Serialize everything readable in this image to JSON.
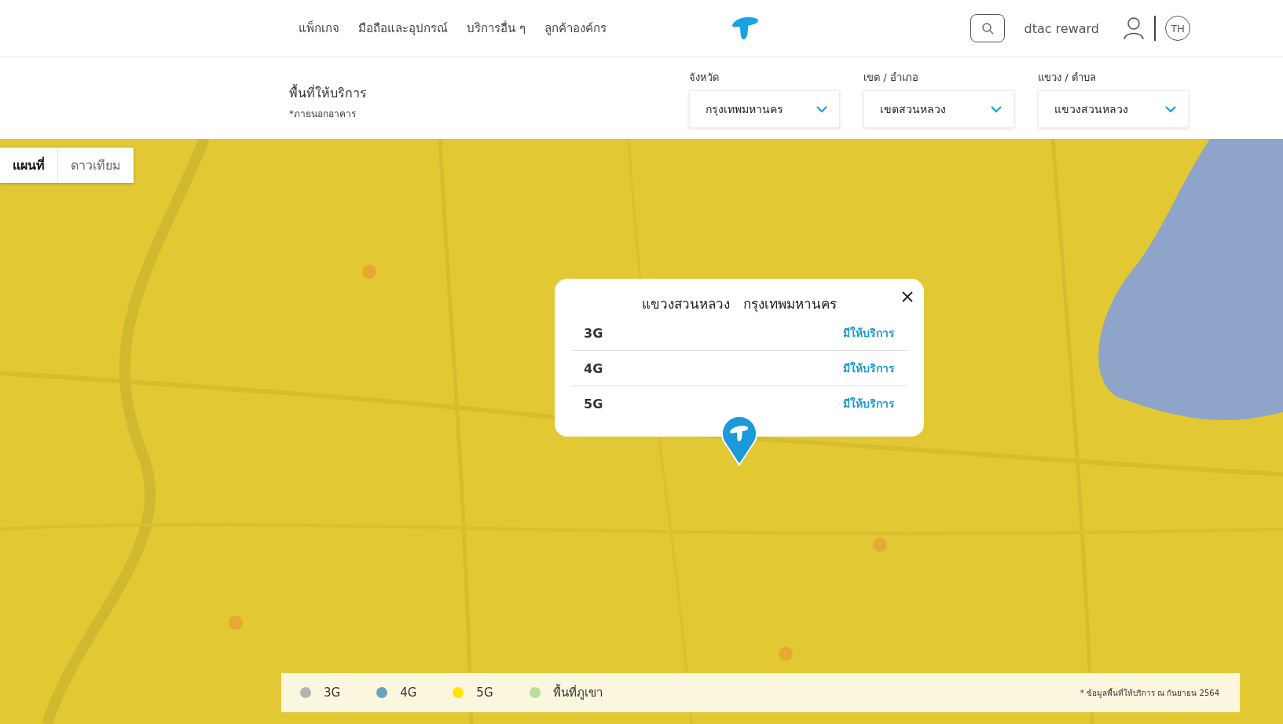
{
  "nav": {
    "items": [
      "แพ็กเกจ",
      "มือถือและอุปกรณ์",
      "บริการอื่น ๆ",
      "ลูกค้าองค์กร"
    ],
    "reward": "dtac reward",
    "language": "TH"
  },
  "filters": {
    "title": "พื้นที่ให้บริการ",
    "note": "*ภายนอกอาคาร",
    "selects": [
      {
        "label": "จังหวัด",
        "value": "กรุงเทพมหานคร"
      },
      {
        "label": "เขต / อำเภอ",
        "value": "เขตสวนหลวง"
      },
      {
        "label": "แขวง / ตำบล",
        "value": "แขวงสวนหลวง"
      }
    ]
  },
  "map_tabs": [
    {
      "label": "แผนที่",
      "selected": true
    },
    {
      "label": "ดาวเทียม",
      "selected": false
    }
  ],
  "popup": {
    "title": "แขวงสวนหลวง   กรุงเทพมหานคร",
    "rows": [
      {
        "network": "3G",
        "status": "มีให้บริการ"
      },
      {
        "network": "4G",
        "status": "มีให้บริการ"
      },
      {
        "network": "5G",
        "status": "มีให้บริการ"
      }
    ]
  },
  "legend": {
    "items": [
      {
        "label": "3G",
        "color": "#b3b3b3"
      },
      {
        "label": "4G",
        "color": "#6aa3bf"
      },
      {
        "label": "5G",
        "color": "#ffe600"
      },
      {
        "label": "พื้นที่ภูเขา",
        "color": "#b9dd9a"
      }
    ],
    "note": "* ข้อมูลพื้นที่ให้บริการ ณ กันยายน 2564"
  }
}
